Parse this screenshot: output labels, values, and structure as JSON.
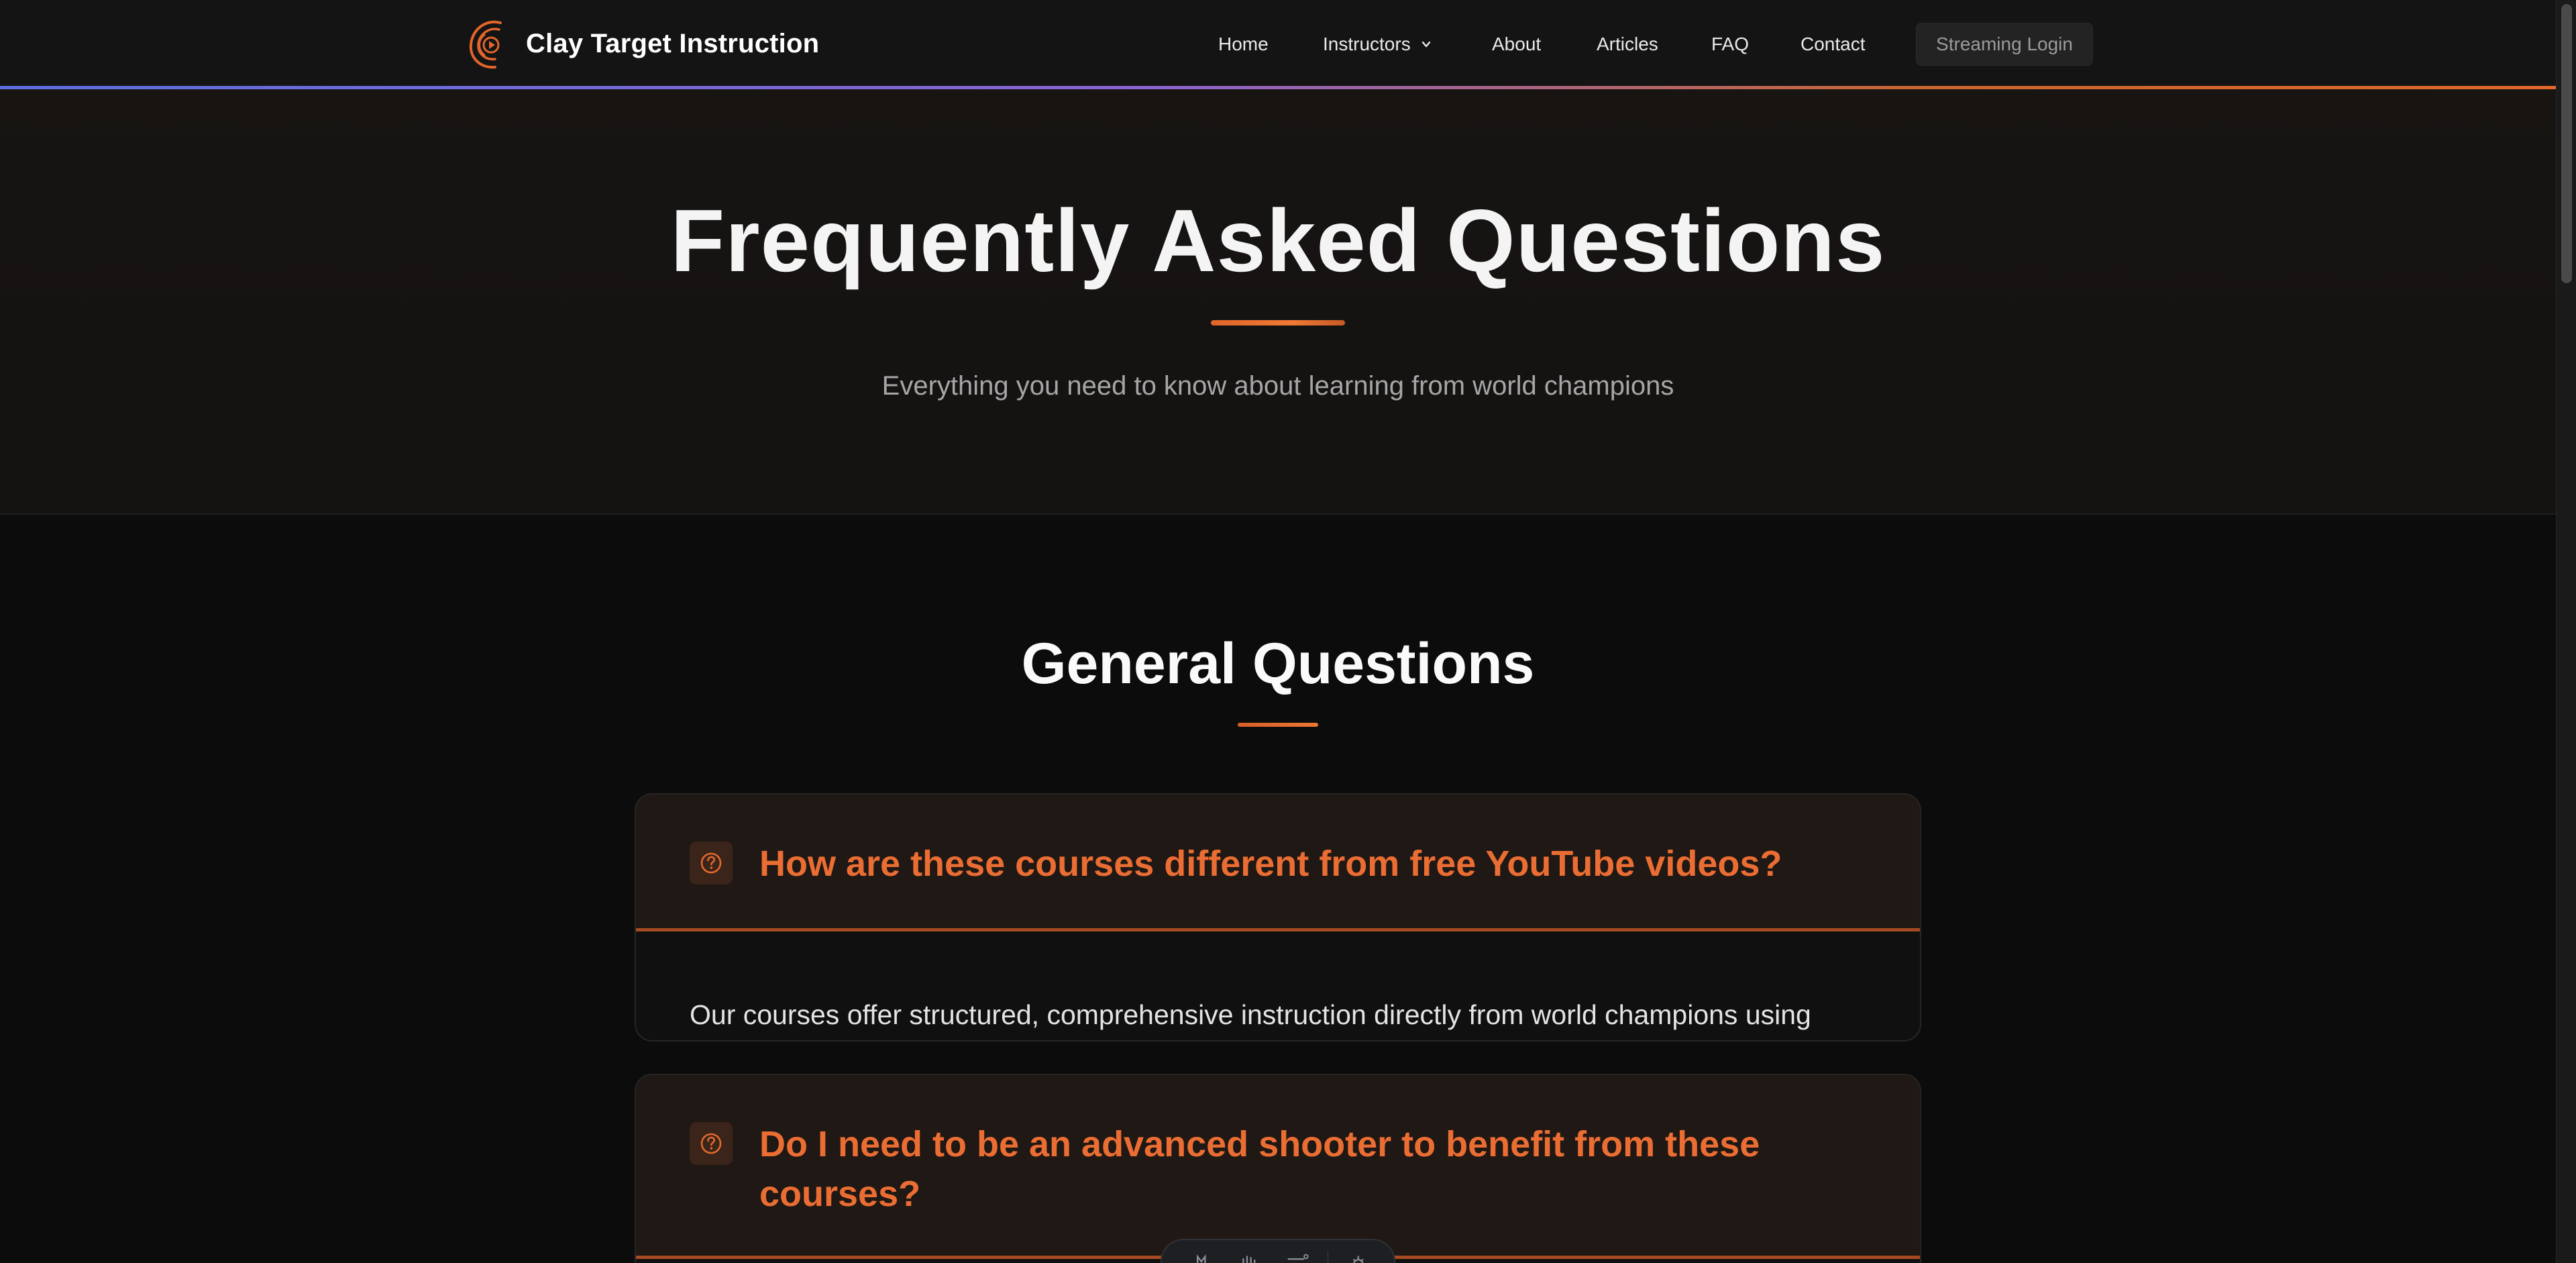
{
  "nav": {
    "brand": "Clay Target Instruction",
    "links": [
      {
        "label": "Home"
      },
      {
        "label": "Instructors",
        "dropdown": true
      },
      {
        "label": "About"
      },
      {
        "label": "Articles"
      },
      {
        "label": "FAQ"
      },
      {
        "label": "Contact"
      }
    ],
    "login_label": "Streaming Login"
  },
  "hero": {
    "title": "Frequently Asked Questions",
    "subtitle": "Everything you need to know about learning from world champions"
  },
  "section": {
    "title": "General Questions"
  },
  "faqs": [
    {
      "question": "How are these courses different from free YouTube videos?",
      "answer": "Our courses offer structured, comprehensive instruction directly from world champions using"
    },
    {
      "question": "Do I need to be an advanced shooter to benefit from these courses?",
      "answer": ""
    }
  ],
  "colors": {
    "accent": "#ea6d33",
    "background": "#0c0c0c",
    "hero_bg": "#161312",
    "card_header": "#201814"
  },
  "icons": {
    "logo": "clay-target-play-icon",
    "faq": "question-circle-icon",
    "dropdown": "chevron-down-icon"
  }
}
